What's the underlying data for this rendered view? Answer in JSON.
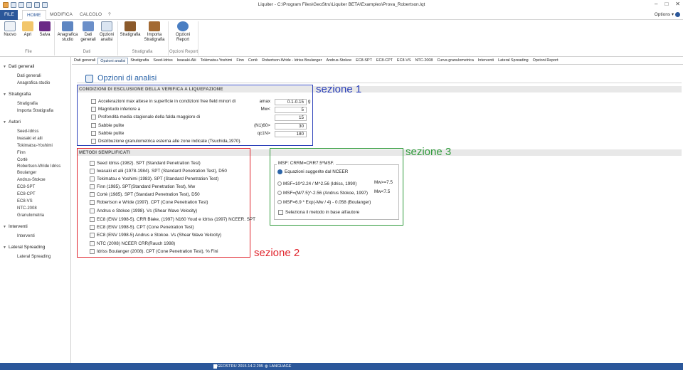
{
  "window": {
    "title": "Liquiter - C:\\Program Files\\GeoStru\\Liquiter BETA\\Examples\\Prova_Robertson.lqt",
    "controls": [
      "–",
      "□",
      "✕"
    ]
  },
  "menu": {
    "file": "FILE",
    "tabs": [
      "HOME",
      "MODIFICA",
      "CALCOLO",
      "?"
    ],
    "options": "Options ▾"
  },
  "ribbon": {
    "buttons": [
      {
        "label": "Nuovo",
        "icon": "new-file-icon",
        "color": "#eef2f7"
      },
      {
        "label": "Apri",
        "icon": "open-folder-icon",
        "color": "#f2c66b"
      },
      {
        "label": "Salva",
        "icon": "save-icon",
        "color": "#6b2a86"
      },
      {
        "label": "Anagrafica studio",
        "icon": "anagraphic-icon",
        "color": "#5e86c2"
      },
      {
        "label": "Dati generali",
        "icon": "people-icon",
        "color": "#6b8fc9"
      },
      {
        "label": "Opzioni analisi",
        "icon": "options-sheet-icon",
        "color": "#dbe5f1"
      },
      {
        "label": "Stratigrafia",
        "icon": "stratigraphy-icon",
        "color": "#8b5a2b"
      },
      {
        "label": "Importa Stratigrafia",
        "icon": "import-stratigraphy-icon",
        "color": "#a36a33"
      },
      {
        "label": "Opzioni Report",
        "icon": "report-options-icon",
        "color": "#4a7ec2"
      }
    ],
    "groups": [
      "File",
      "Dati",
      "Stratigrafia",
      "Opzioni Report"
    ]
  },
  "sidebar": {
    "sections": [
      {
        "title": "Dati generali",
        "items": [
          "Dati generali",
          "Anagrafica studio"
        ]
      },
      {
        "title": "Stratigrafia",
        "items": [
          "Stratigrafia",
          "Importa Stratigrafia"
        ]
      },
      {
        "title": "Autori",
        "items": [
          "Seed-Idriss",
          "Iwasaki et alii",
          "Tokimatsu-Yoshimi",
          "Finn",
          "Cortè",
          "Robertson-Wride Idriss Boulanger",
          "Andrus-Stokoe",
          "EC8-SPT",
          "EC8-CPT",
          "EC8-VS",
          "NTC-2008",
          "Granulometria"
        ]
      },
      {
        "title": "Interventi",
        "items": [
          "Interventi"
        ]
      },
      {
        "title": "Lateral Spreading",
        "items": [
          "Lateral Spreading"
        ]
      }
    ]
  },
  "content_tabs": [
    "Dati generali",
    "Opzioni analisi",
    "Stratigrafia",
    "Seed-Idriss",
    "Iwasaki-Alii",
    "Tokimatsu-Yoshimi",
    "Finn",
    "Cortè",
    "Robertson-Wride - Idriss Boulanger",
    "Andrus-Stokoe",
    "EC8-SPT",
    "EC8-CPT",
    "EC8-VS",
    "NTC-2008",
    "Curva granulometrica",
    "Interventi",
    "Lateral Spreading",
    "Opzioni Report"
  ],
  "page": {
    "title": "Opzioni di analisi"
  },
  "section1": {
    "label": "sezione 1",
    "color": "#2a3fb8",
    "band": "CONDIZIONI DI ESCLUSIONE DELLA VERIFICA A LIQUEFAZIONE",
    "rows": [
      {
        "label": "Accelerazioni max attese in superficie in condizioni free field minori di",
        "param": "amax",
        "value": "0.1-0.15",
        "unit": "g"
      },
      {
        "label": "Magnitudo inferiore a",
        "param": "Mw<",
        "value": "5",
        "unit": ""
      },
      {
        "label": "Profondità media stagionale della falda maggiore di",
        "param": "",
        "value": "15",
        "unit": ""
      },
      {
        "label": "Sabbie pulite",
        "param": "(N1)60>",
        "value": "30",
        "unit": ""
      },
      {
        "label": "Sabbie pulite",
        "param": "qc1N>",
        "value": "180",
        "unit": ""
      },
      {
        "label": "Distribuzione granulometrica esterna alle zone indicate (Tsuchida,1970).",
        "param": "",
        "value": "",
        "unit": ""
      }
    ]
  },
  "section2": {
    "label": "sezione 2",
    "color": "#e0242c",
    "band": "METODI SEMPLIFICATI",
    "methods": [
      "Seed Idriss (1982). SPT (Standard Penetration Test)",
      "Iwasaki et alii (1978-1984). SPT (Standard Penetration Test), D50",
      "Tokimatsu e Yoshimi (1983). SPT (Standard Penetration Test)",
      "Finn (1985). SPT(Standard Penetration Test), Mw",
      "Cortè (1985). SPT (Standard Penetration Test), D50",
      "Robertson e Wride (1997). CPT (Cone Penetration Test)",
      "Andrus e Stokoe (1998). Vs (Shear Wave Velocity)",
      "EC8 (ENV 1998-5). CRR Blake, (1997) N160 Youd e Idriss (1997) NCEER. SPT",
      "EC8 (ENV 1998-5). CPT (Cone Penetration Test)",
      "EC8 (ENV 1998-5) Andrus e Stokoe. Vs (Shear Wave Velocity)",
      "NTC (2008) NCEER CRR(Rauch 1998)",
      "Idriss Boulanger (2008). CPT (Cone Penetration Test), % Fini"
    ]
  },
  "section3": {
    "label": "sezione 3",
    "color": "#2f9a3a",
    "legend": "MSF: CRRM=CRR7.5*MSF.",
    "info": "Equazioni suggerite dal NCEER",
    "options": [
      {
        "label": "MSF=10^2.24 / M^2.56 (Idriss, 1990)",
        "note": "Mw>=7.5"
      },
      {
        "label": "MSF=(M/7.5)^-2.56 (Andrus Stokoe, 1997)",
        "note": "Mw<7.5"
      },
      {
        "label": "MSF=6.9 * Exp(-Mw / 4) - 0.058 (Boulanger)",
        "note": ""
      }
    ],
    "auto": "Seleziona il metodo in base all'autore"
  },
  "status": {
    "version": "GEOSTRU 2015.14.2.295",
    "language": "LANGUAGE"
  }
}
